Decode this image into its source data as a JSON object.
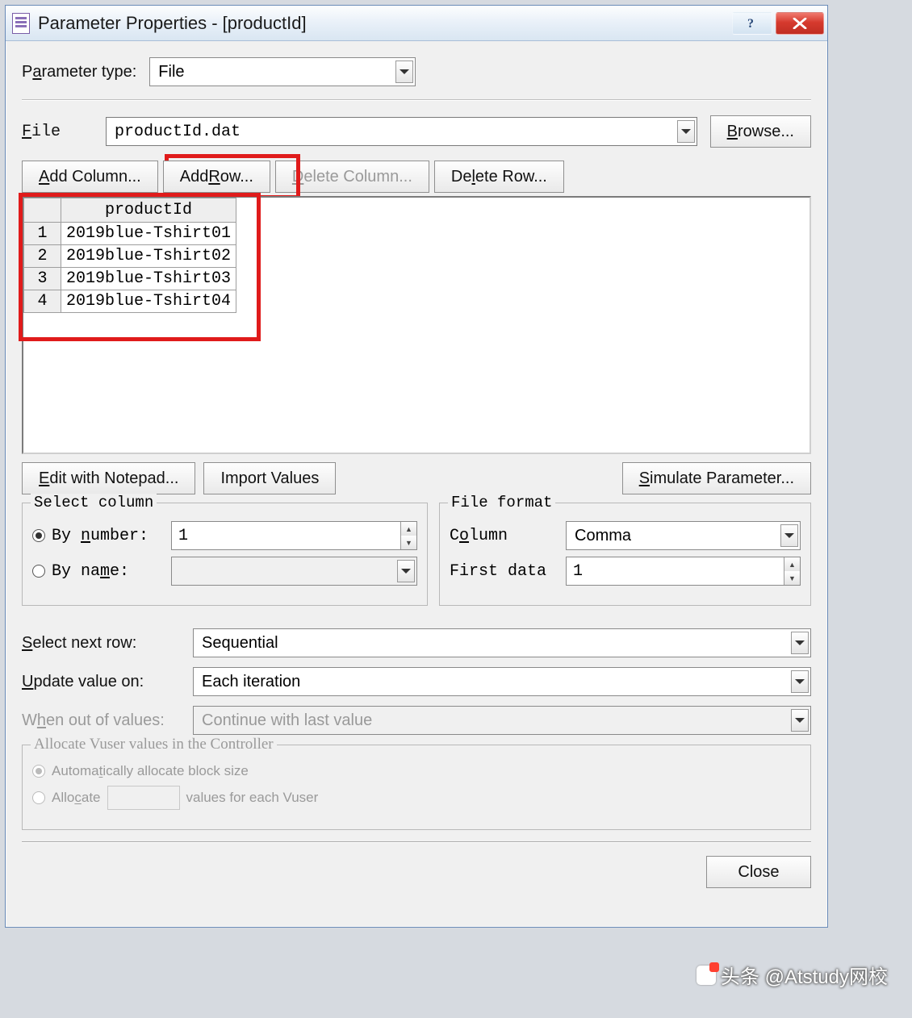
{
  "window": {
    "title": "Parameter Properties - [productId]"
  },
  "titlebar": {
    "help_tooltip": "Help",
    "close_tooltip": "Close"
  },
  "param_type": {
    "label_pre": "P",
    "label_u": "a",
    "label_post": "rameter type:",
    "value": "File"
  },
  "file": {
    "label_pre": "",
    "label_u": "F",
    "label_post": "ile",
    "value": "productId.dat",
    "browse_pre": "",
    "browse_u": "B",
    "browse_post": "rowse..."
  },
  "buttons": {
    "add_col_pre": "",
    "add_col_u": "A",
    "add_col_post": "dd Column...",
    "add_row_pre": "Add ",
    "add_row_u": "R",
    "add_row_post": "ow...",
    "del_col_pre": "",
    "del_col_u": "D",
    "del_col_post": "elete Column...",
    "del_row_pre": "De",
    "del_row_u": "l",
    "del_row_post": "ete Row...",
    "edit_np_pre": "",
    "edit_np_u": "E",
    "edit_np_post": "dit with Notepad...",
    "import": "Import Values",
    "sim_pre": "",
    "sim_u": "S",
    "sim_post": "imulate Parameter...",
    "close": "Close"
  },
  "table": {
    "column": "productId",
    "rows": [
      "2019blue-Tshirt01",
      "2019blue-Tshirt02",
      "2019blue-Tshirt03",
      "2019blue-Tshirt04"
    ]
  },
  "select_column": {
    "legend": "Select column",
    "by_number_pre": "By ",
    "by_number_u": "n",
    "by_number_post": "umber:",
    "by_name_pre": "By na",
    "by_name_u": "m",
    "by_name_post": "e:",
    "number_value": "1",
    "name_value": ""
  },
  "file_format": {
    "legend": "File format",
    "column_pre": "C",
    "column_u": "o",
    "column_post": "lumn",
    "column_value": "Comma",
    "first_data": "First data",
    "first_data_value": "1"
  },
  "selectors": {
    "next_row_pre": "",
    "next_row_u": "S",
    "next_row_post": "elect next row:",
    "next_row_value": "Sequential",
    "update_pre": "",
    "update_u": "U",
    "update_post": "pdate value on:",
    "update_value": "Each iteration",
    "when_out_pre": "W",
    "when_out_u": "h",
    "when_out_post": "en out of values:",
    "when_out_value": "Continue with last value"
  },
  "allocate": {
    "legend": "Allocate Vuser values in the Controller",
    "auto_pre": "Automa",
    "auto_u": "t",
    "auto_post": "ically allocate block size",
    "alloc_pre": "Allo",
    "alloc_u": "c",
    "alloc_post": "ate",
    "values_each": "values for each Vuser",
    "alloc_value": ""
  },
  "watermark": "头条 @Atstudy网校"
}
